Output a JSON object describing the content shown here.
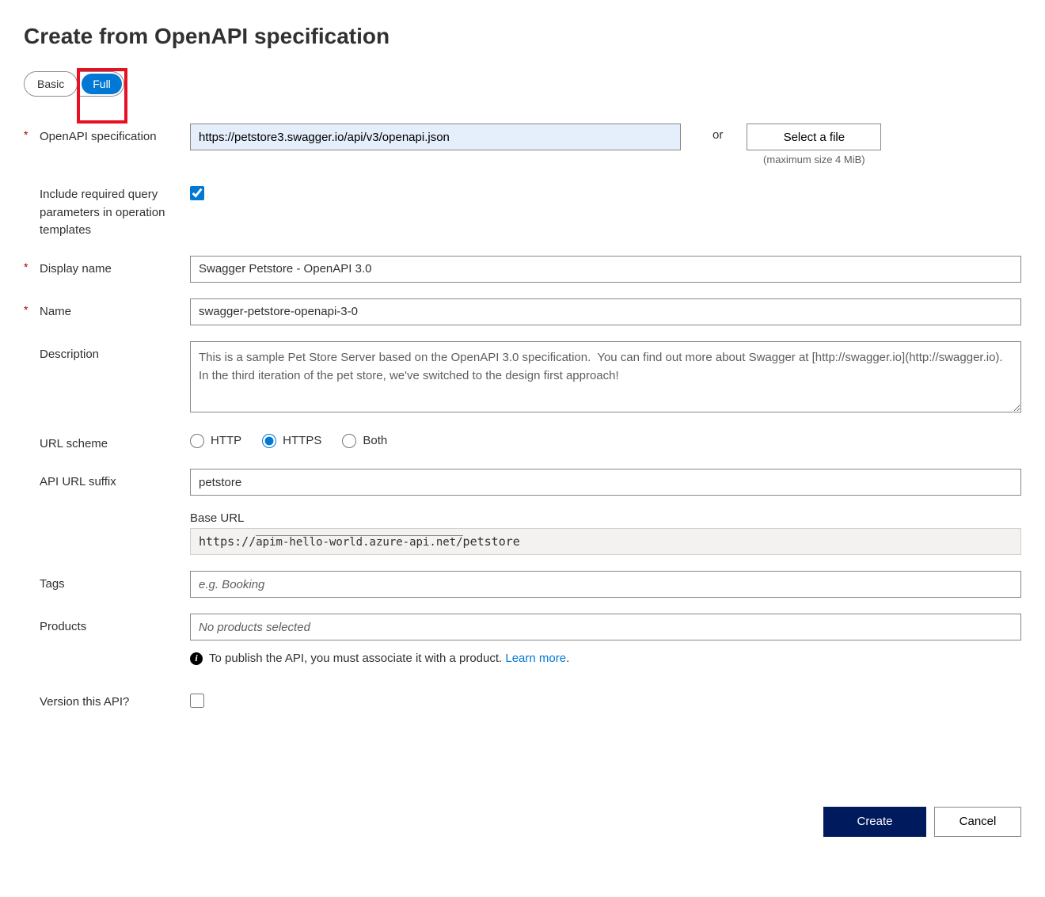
{
  "title": "Create from OpenAPI specification",
  "toggle": {
    "basic": "Basic",
    "full": "Full"
  },
  "fields": {
    "spec": {
      "label": "OpenAPI specification",
      "value": "https://petstore3.swagger.io/api/v3/openapi.json",
      "or": "or",
      "select_file": "Select a file",
      "max_size": "(maximum size 4 MiB)"
    },
    "include_query": {
      "label": "Include required query parameters in operation templates",
      "checked": true
    },
    "display_name": {
      "label": "Display name",
      "value": "Swagger Petstore - OpenAPI 3.0"
    },
    "name": {
      "label": "Name",
      "value": "swagger-petstore-openapi-3-0"
    },
    "description": {
      "label": "Description",
      "value": "This is a sample Pet Store Server based on the OpenAPI 3.0 specification.  You can find out more about Swagger at [http://swagger.io](http://swagger.io). In the third iteration of the pet store, we've switched to the design first approach!"
    },
    "url_scheme": {
      "label": "URL scheme",
      "http": "HTTP",
      "https": "HTTPS",
      "both": "Both",
      "selected": "https"
    },
    "suffix": {
      "label": "API URL suffix",
      "value": "petstore",
      "base_url_label": "Base URL",
      "base_proto": "https://",
      "base_host": "apim-hello-world.azure-api.net/",
      "base_suffix": "petstore"
    },
    "tags": {
      "label": "Tags",
      "placeholder": "e.g. Booking"
    },
    "products": {
      "label": "Products",
      "placeholder": "No products selected",
      "hint_pre": "To publish the API, you must associate it with a product. ",
      "hint_link": "Learn more",
      "hint_post": "."
    },
    "version": {
      "label": "Version this API?",
      "checked": false
    }
  },
  "footer": {
    "create": "Create",
    "cancel": "Cancel"
  }
}
